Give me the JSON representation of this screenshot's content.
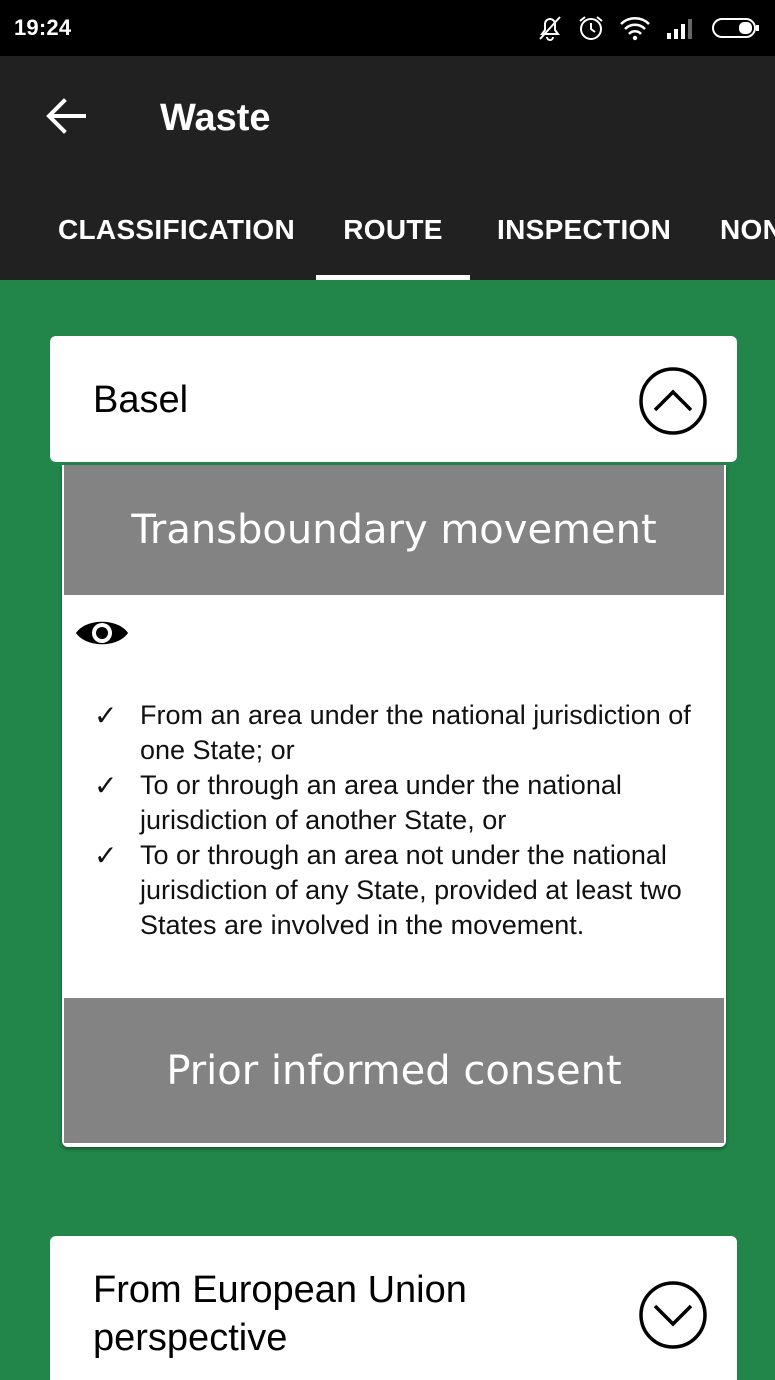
{
  "status_bar": {
    "time": "19:24",
    "icons": [
      "silent-bell-icon",
      "alarm-icon",
      "wifi-icon",
      "signal-icon",
      "battery-icon"
    ]
  },
  "app_bar": {
    "title": "Waste",
    "back_icon": "back-arrow-icon"
  },
  "tabs": [
    {
      "label": "CLASSIFICATION",
      "selected": false
    },
    {
      "label": "ROUTE",
      "selected": true
    },
    {
      "label": "INSPECTION",
      "selected": false
    },
    {
      "label": "NON",
      "selected": false
    }
  ],
  "cards": [
    {
      "title": "Basel",
      "expanded": true,
      "toggle_icon": "chevron-up-circle-icon",
      "sections": [
        {
          "heading": "Transboundary movement",
          "icon": "eye-icon",
          "items": [
            "From an area under the national jurisdiction of one State; or",
            "To or through an area under the national jurisdiction of another State, or",
            "To or through an area not under the national jurisdiction of any State, provided at least two States are involved in the movement."
          ]
        },
        {
          "heading": "Prior informed consent"
        }
      ]
    },
    {
      "title": "From European Union perspective",
      "expanded": false,
      "toggle_icon": "chevron-down-circle-icon"
    }
  ],
  "colors": {
    "app_bar": "#212121",
    "content_background": "#22854a",
    "section_heading": "#838383"
  },
  "check_mark": "✓"
}
